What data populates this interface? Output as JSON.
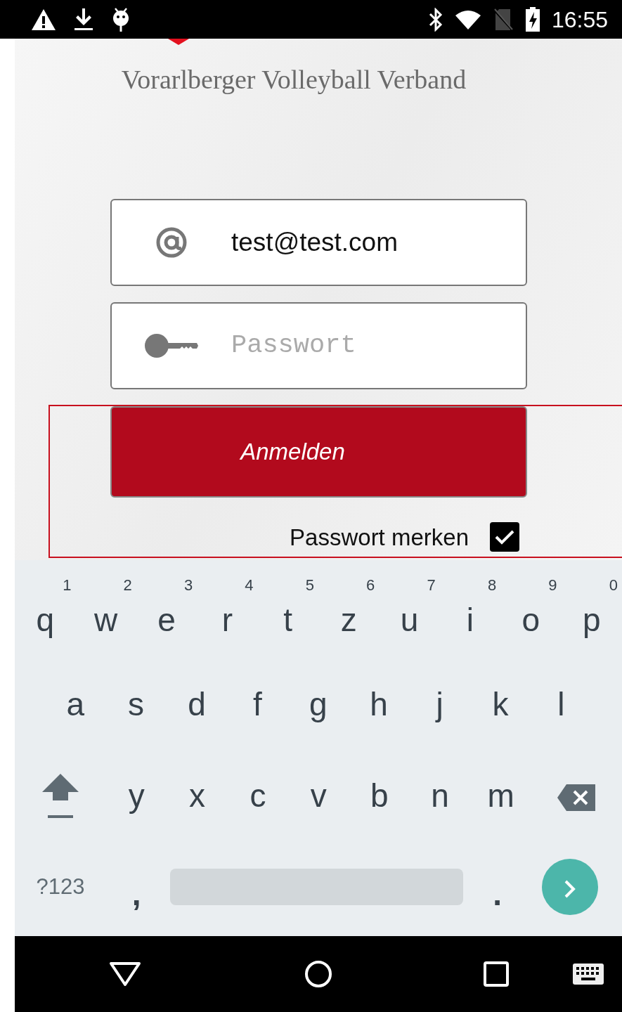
{
  "status_bar": {
    "time": "16:55"
  },
  "header": {
    "title": "Vorarlberger Volleyball Verband"
  },
  "login": {
    "email": {
      "value": "test@test.com"
    },
    "password": {
      "placeholder": "Passwort"
    },
    "submit": {
      "label": "Anmelden"
    },
    "remember": {
      "label": "Passwort merken",
      "checked": true
    }
  },
  "keyboard": {
    "rows": [
      [
        {
          "kind": "char",
          "label": "q",
          "hint": "1"
        },
        {
          "kind": "char",
          "label": "w",
          "hint": "2"
        },
        {
          "kind": "char",
          "label": "e",
          "hint": "3"
        },
        {
          "kind": "char",
          "label": "r",
          "hint": "4"
        },
        {
          "kind": "char",
          "label": "t",
          "hint": "5"
        },
        {
          "kind": "char",
          "label": "z",
          "hint": "6"
        },
        {
          "kind": "char",
          "label": "u",
          "hint": "7"
        },
        {
          "kind": "char",
          "label": "i",
          "hint": "8"
        },
        {
          "kind": "char",
          "label": "o",
          "hint": "9"
        },
        {
          "kind": "char",
          "label": "p",
          "hint": "0"
        }
      ],
      [
        {
          "kind": "char",
          "label": "a"
        },
        {
          "kind": "char",
          "label": "s"
        },
        {
          "kind": "char",
          "label": "d"
        },
        {
          "kind": "char",
          "label": "f"
        },
        {
          "kind": "char",
          "label": "g"
        },
        {
          "kind": "char",
          "label": "h"
        },
        {
          "kind": "char",
          "label": "j"
        },
        {
          "kind": "char",
          "label": "k"
        },
        {
          "kind": "char",
          "label": "l"
        }
      ],
      [
        {
          "kind": "shift"
        },
        {
          "kind": "char",
          "label": "y"
        },
        {
          "kind": "char",
          "label": "x"
        },
        {
          "kind": "char",
          "label": "c"
        },
        {
          "kind": "char",
          "label": "v"
        },
        {
          "kind": "char",
          "label": "b"
        },
        {
          "kind": "char",
          "label": "n"
        },
        {
          "kind": "char",
          "label": "m"
        },
        {
          "kind": "backspace"
        }
      ]
    ],
    "bottom_row": {
      "symbols_key": "?123",
      "comma_key": ",",
      "period_key": "."
    }
  }
}
